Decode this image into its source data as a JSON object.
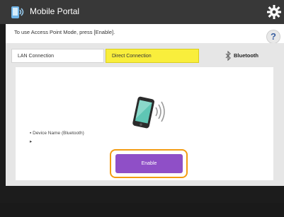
{
  "header": {
    "title": "Mobile Portal",
    "app_icon": "mobile-portal-icon",
    "settings_icon": "gear-icon"
  },
  "instruction": {
    "text": "To use Access Point Mode, press [Enable].",
    "help_label": "?"
  },
  "tabs": [
    {
      "label": "LAN Connection",
      "selected": false
    },
    {
      "label": "Direct Connection",
      "selected": true
    },
    {
      "label": "Bluetooth",
      "selected": false
    }
  ],
  "device": {
    "label": "Device Name (Bluetooth)",
    "value": ""
  },
  "actions": {
    "enable_label": "Enable"
  },
  "colors": {
    "selected_tab": "#f9ee3c",
    "enable_button": "#8f4fc7",
    "highlight_ring": "#f39c12"
  }
}
